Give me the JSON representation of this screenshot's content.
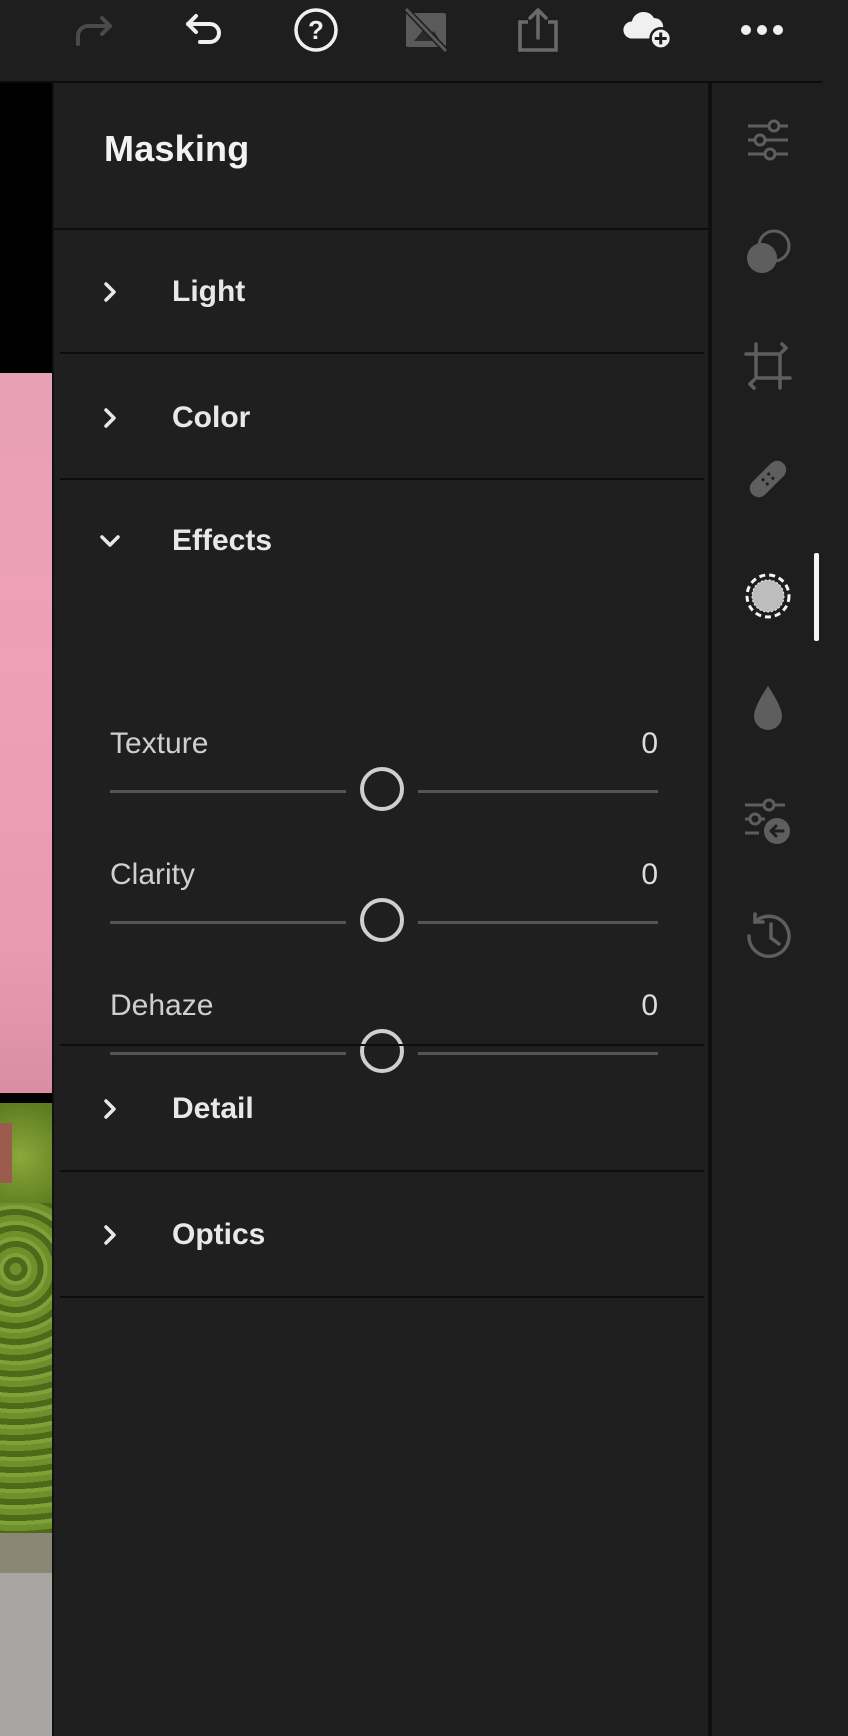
{
  "toolbar": {
    "icons": [
      "redo-icon",
      "undo-icon",
      "help-icon",
      "compare-off-icon",
      "share-icon",
      "cloud-add-icon",
      "more-icon"
    ]
  },
  "panel": {
    "title": "Masking",
    "sections": [
      {
        "label": "Light",
        "expanded": false
      },
      {
        "label": "Color",
        "expanded": false
      },
      {
        "label": "Effects",
        "expanded": true
      },
      {
        "label": "Detail",
        "expanded": false
      },
      {
        "label": "Optics",
        "expanded": false
      }
    ],
    "effects": [
      {
        "label": "Texture",
        "value": "0"
      },
      {
        "label": "Clarity",
        "value": "0"
      },
      {
        "label": "Dehaze",
        "value": "0"
      }
    ]
  },
  "rail": {
    "icons": [
      "edit-sliders-icon",
      "presets-icon",
      "crop-icon",
      "healing-icon",
      "masking-icon",
      "color-drop-icon",
      "versions-icon",
      "history-icon"
    ],
    "active": "masking-icon"
  },
  "colors": {
    "background": "#1e1e1e",
    "panel": "#1f1f1f",
    "text": "#e8e8e8",
    "muted_icon": "#5a5a5a",
    "active_indicator": "#f5f5f5"
  }
}
